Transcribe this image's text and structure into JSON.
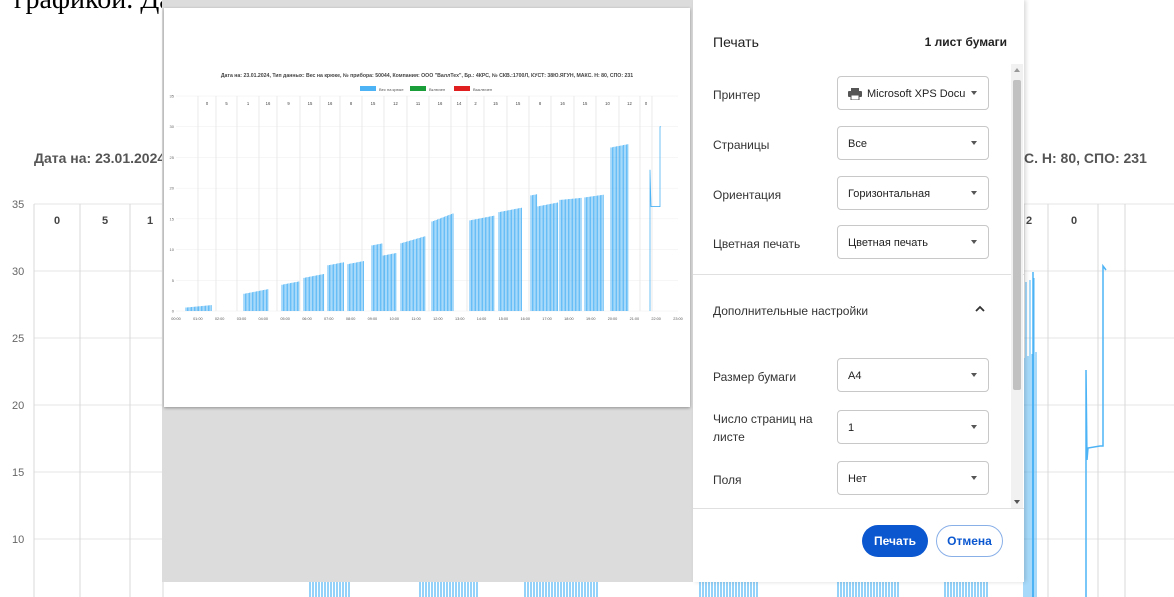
{
  "background": {
    "top_text": "графикой. Данные получаются",
    "chart_title_left": "Дата на: 23.01.2024,",
    "chart_title_right": "С. Н: 80, СПО: 231",
    "y_ticks": [
      "35",
      "30",
      "25",
      "20",
      "15",
      "10"
    ],
    "segment_labels_left": [
      "0",
      "5",
      "1"
    ],
    "segment_labels_right": [
      "2",
      "0"
    ]
  },
  "preview": {
    "title": "Дата на: 23.01.2024, Тип данных: Вес на крюке, № прибора: 50044, Компания: ООО \"ВаллТех\", Бр.: 4КРС, № СКВ.:1700Л, КУСТ: 38Ю.ЯГУН, МАКС. Н: 80, СПО: 231",
    "legend": [
      "Вес на крюке",
      "Включен",
      "Выключен"
    ],
    "legend_colors": [
      "#4db3f5",
      "#1a9e3a",
      "#e02020"
    ],
    "y_ticks": [
      "35",
      "30",
      "25",
      "20",
      "15",
      "10",
      "5",
      "0"
    ],
    "x_ticks": [
      "00:00",
      "01:00",
      "02:00",
      "03:00",
      "04:00",
      "05:00",
      "06:00",
      "07:00",
      "08:00",
      "09:00",
      "10:00",
      "11:00",
      "12:00",
      "13:00",
      "14:00",
      "15:00",
      "16:00",
      "17:00",
      "18:00",
      "19:00",
      "20:00",
      "21:00",
      "22:00",
      "23:00"
    ],
    "segment_labels": [
      "0",
      "5",
      "1",
      "16",
      "9",
      "15",
      "16",
      "8",
      "15",
      "12",
      "11",
      "16",
      "14",
      "2",
      "15",
      "15",
      "8",
      "16",
      "15",
      "10",
      "12",
      "0"
    ]
  },
  "dialog": {
    "title": "Печать",
    "sheets": "1 лист бумаги",
    "fields": [
      {
        "label": "Принтер",
        "value": "Microsoft XPS Document Writer"
      },
      {
        "label": "Страницы",
        "value": "Все"
      },
      {
        "label": "Ориентация",
        "value": "Горизонтальная"
      },
      {
        "label": "Цветная печать",
        "value": "Цветная печать"
      }
    ],
    "advanced_label": "Дополнительные настройки",
    "advanced_fields": [
      {
        "label": "Размер бумаги",
        "value": "A4"
      },
      {
        "label": "Число страниц на листе",
        "value": "1"
      },
      {
        "label": "Поля",
        "value": "Нет"
      }
    ],
    "print_button": "Печать",
    "cancel_button": "Отмена"
  },
  "colors": {
    "accent": "#0b57d0",
    "series": "#4db3f5"
  }
}
